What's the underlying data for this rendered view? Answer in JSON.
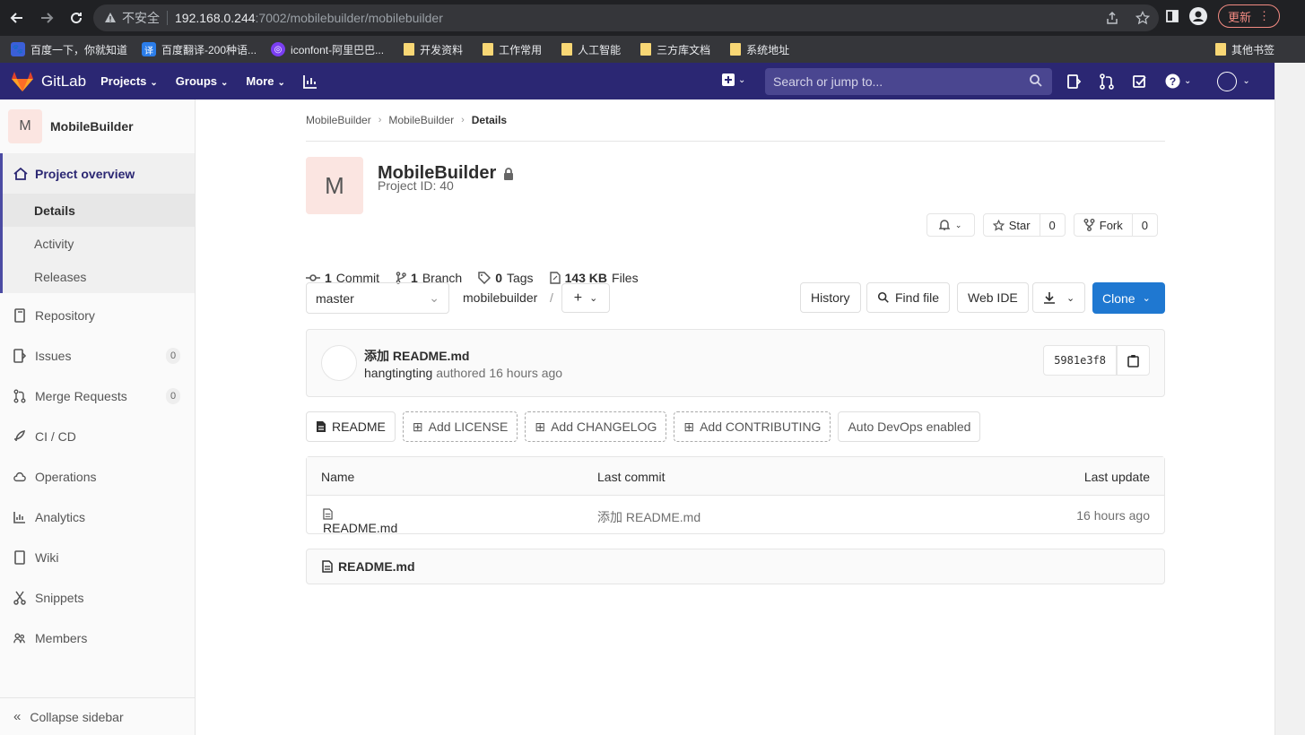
{
  "browser": {
    "insecure_label": "不安全",
    "url_host": "192.168.0.244",
    "url_path": ":7002/mobilebuilder/mobilebuilder",
    "update_label": "更新"
  },
  "bookmarks": [
    {
      "label": "百度一下，你就知道",
      "icon": "baidu-icon",
      "color": "#3b5fd8"
    },
    {
      "label": "百度翻译-200种语...",
      "icon": "translate-icon",
      "color": "#2b7de9"
    },
    {
      "label": "iconfont-阿里巴巴...",
      "icon": "iconfont-icon",
      "color": "#7a3ef2"
    },
    {
      "label": "开发资料",
      "icon": "folder-icon"
    },
    {
      "label": "工作常用",
      "icon": "folder-icon"
    },
    {
      "label": "人工智能",
      "icon": "folder-icon"
    },
    {
      "label": "三方库文档",
      "icon": "folder-icon"
    },
    {
      "label": "系统地址",
      "icon": "folder-icon"
    }
  ],
  "bookmarks_other": "其他书签",
  "gitlab": {
    "brand": "GitLab",
    "menu": [
      "Projects",
      "Groups",
      "More"
    ],
    "search_placeholder": "Search or jump to..."
  },
  "sidebar": {
    "project_initial": "M",
    "project_name": "MobileBuilder",
    "overview": "Project overview",
    "overview_sub": [
      "Details",
      "Activity",
      "Releases"
    ],
    "items": [
      {
        "label": "Repository",
        "icon": "book-icon"
      },
      {
        "label": "Issues",
        "icon": "issues-icon",
        "badge": "0"
      },
      {
        "label": "Merge Requests",
        "icon": "merge-icon",
        "badge": "0"
      },
      {
        "label": "CI / CD",
        "icon": "rocket-icon"
      },
      {
        "label": "Operations",
        "icon": "cloud-icon"
      },
      {
        "label": "Analytics",
        "icon": "chart-icon"
      },
      {
        "label": "Wiki",
        "icon": "wiki-icon"
      },
      {
        "label": "Snippets",
        "icon": "scissors-icon"
      },
      {
        "label": "Members",
        "icon": "users-icon"
      }
    ],
    "collapse": "Collapse sidebar"
  },
  "breadcrumbs": [
    "MobileBuilder",
    "MobileBuilder",
    "Details"
  ],
  "project": {
    "initial": "M",
    "name": "MobileBuilder",
    "id_text": "Project ID: 40",
    "star_label": "Star",
    "star_count": "0",
    "fork_label": "Fork",
    "fork_count": "0",
    "stats": [
      {
        "num": "1",
        "label": "Commit"
      },
      {
        "num": "1",
        "label": "Branch"
      },
      {
        "num": "0",
        "label": "Tags"
      },
      {
        "num": "143 KB",
        "label": "Files"
      }
    ]
  },
  "repo": {
    "branch": "master",
    "path": "mobilebuilder",
    "history": "History",
    "find_file": "Find file",
    "web_ide": "Web IDE",
    "clone": "Clone"
  },
  "commit": {
    "title": "添加 README.md",
    "author": "hangtingting",
    "meta": "authored 16 hours ago",
    "sha": "5981e3f8"
  },
  "file_buttons": [
    "README",
    "Add LICENSE",
    "Add CHANGELOG",
    "Add CONTRIBUTING",
    "Auto DevOps enabled"
  ],
  "table": {
    "headers": [
      "Name",
      "Last commit",
      "Last update"
    ],
    "rows": [
      {
        "name": "README.md",
        "commit": "添加 README.md",
        "updated": "16 hours ago"
      }
    ]
  },
  "readme_title": "README.md"
}
